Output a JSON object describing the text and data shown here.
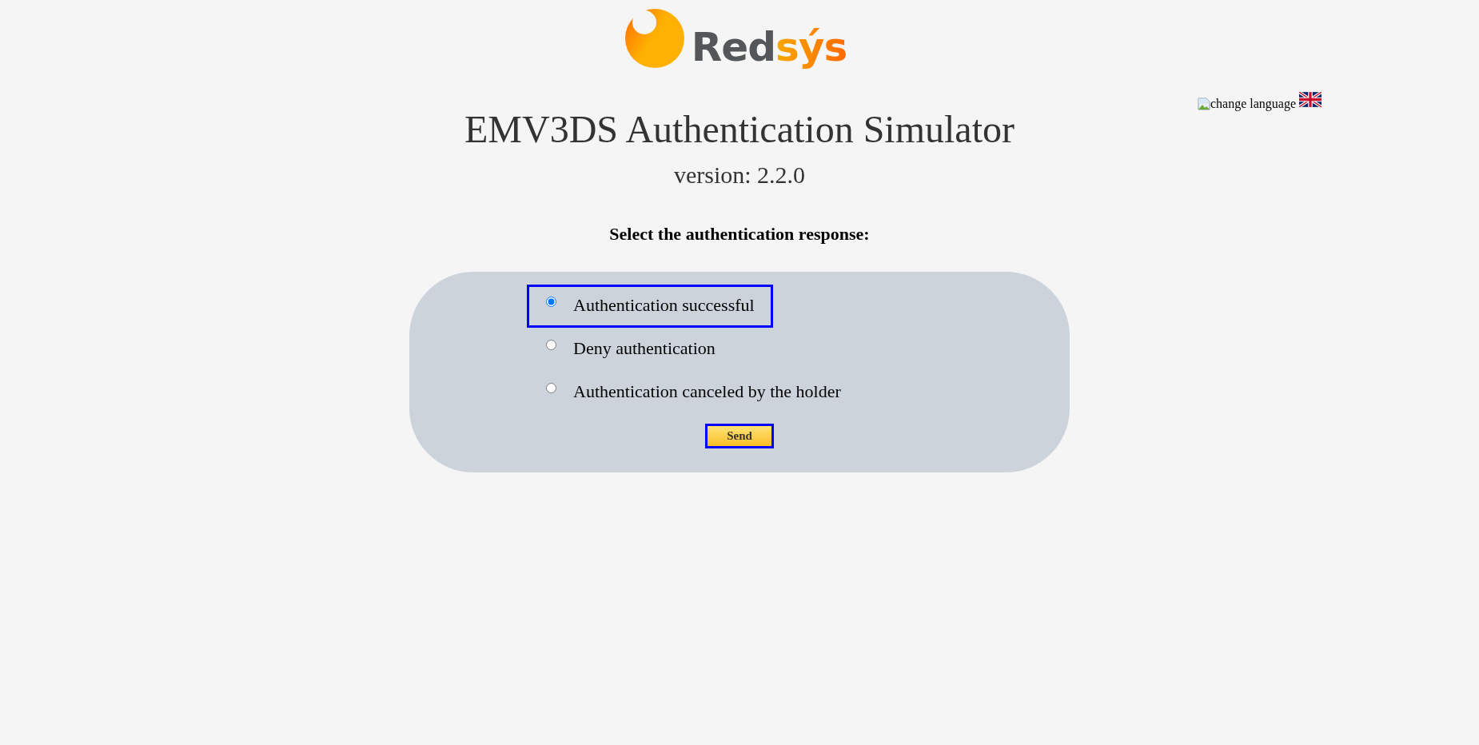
{
  "logo": {
    "name": "Red",
    "accent": "sýs"
  },
  "language": {
    "label": "change language"
  },
  "title": "EMV3DS Authentication Simulator",
  "version": "version: 2.2.0",
  "prompt": "Select the authentication response:",
  "options": [
    {
      "label": "Authentication successful",
      "selected": true
    },
    {
      "label": "Deny authentication",
      "selected": false
    },
    {
      "label": "Authentication canceled by the holder",
      "selected": false
    }
  ],
  "button": "Send"
}
